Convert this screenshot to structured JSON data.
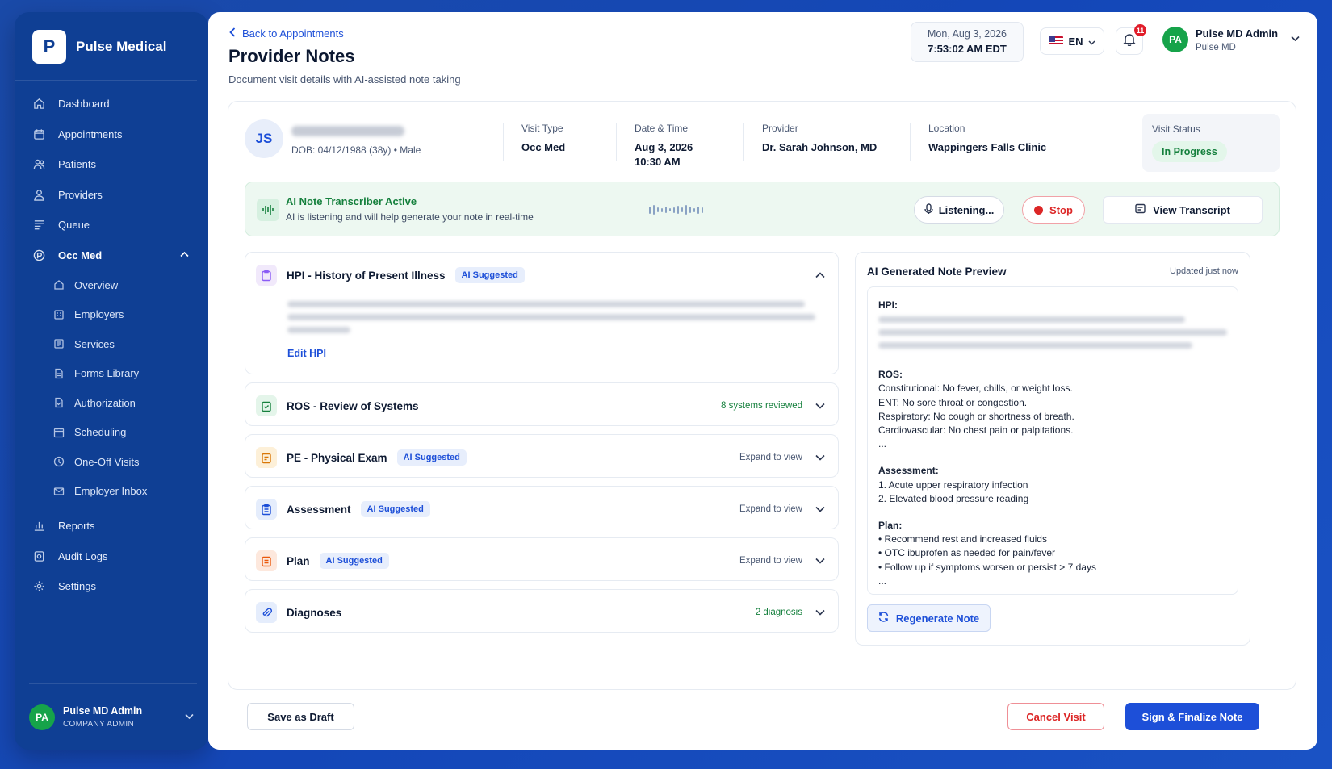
{
  "brand": {
    "logo_letter": "P",
    "name": "Pulse Medical"
  },
  "sidebar": {
    "items": [
      {
        "label": "Dashboard",
        "icon": "home-icon"
      },
      {
        "label": "Appointments",
        "icon": "calendar-icon"
      },
      {
        "label": "Patients",
        "icon": "users-icon"
      },
      {
        "label": "Providers",
        "icon": "provider-icon"
      },
      {
        "label": "Queue",
        "icon": "queue-icon"
      }
    ],
    "occ_med": {
      "label": "Occ Med",
      "sub_items": [
        {
          "label": "Overview"
        },
        {
          "label": "Employers"
        },
        {
          "label": "Services"
        },
        {
          "label": "Forms Library"
        },
        {
          "label": "Authorization"
        },
        {
          "label": "Scheduling"
        },
        {
          "label": "One-Off Visits"
        },
        {
          "label": "Employer Inbox"
        }
      ]
    },
    "bottom_items": [
      {
        "label": "Reports"
      },
      {
        "label": "Audit Logs"
      },
      {
        "label": "Settings"
      }
    ],
    "user": {
      "initials": "PA",
      "name": "Pulse MD Admin",
      "role": "COMPANY ADMIN"
    }
  },
  "header": {
    "back_link": "Back to Appointments",
    "title": "Provider Notes",
    "subtitle": "Document visit details with AI-assisted note taking",
    "date": "Mon, Aug 3, 2026",
    "time": "7:53:02 AM EDT",
    "language": "EN",
    "notification_count": "11",
    "user": {
      "initials": "PA",
      "name": "Pulse MD Admin",
      "org": "Pulse MD"
    }
  },
  "patient": {
    "initials": "JS",
    "dob_line": "DOB: 04/12/1988 (38y) • Male",
    "visit_type_label": "Visit Type",
    "visit_type": "Occ Med",
    "datetime_label": "Date & Time",
    "date": "Aug 3, 2026",
    "time": "10:30 AM",
    "provider_label": "Provider",
    "provider": "Dr. Sarah Johnson, MD",
    "location_label": "Location",
    "location": "Wappingers Falls Clinic",
    "status_label": "Visit Status",
    "status": "In Progress"
  },
  "ai_banner": {
    "title": "AI Note Transcriber Active",
    "subtitle": "AI is listening and will help generate your note in real-time",
    "listening_label": "Listening...",
    "stop_label": "Stop",
    "transcript_label": "View Transcript"
  },
  "sections": {
    "hpi": {
      "title": "HPI - History of Present Illness",
      "tag": "AI Suggested",
      "edit_label": "Edit HPI"
    },
    "ros": {
      "title": "ROS - Review of Systems",
      "right": "8 systems reviewed"
    },
    "pe": {
      "title": "PE - Physical Exam",
      "tag": "AI Suggested",
      "right": "Expand to view"
    },
    "assessment": {
      "title": "Assessment",
      "tag": "AI Suggested",
      "right": "Expand to view"
    },
    "plan": {
      "title": "Plan",
      "tag": "AI Suggested",
      "right": "Expand to view"
    },
    "diagnoses": {
      "title": "Diagnoses",
      "right": "2 diagnosis"
    }
  },
  "preview": {
    "title": "AI Generated Note Preview",
    "updated": "Updated just now",
    "hpi_heading": "HPI:",
    "ros_heading": "ROS:",
    "ros_lines": [
      "Constitutional: No fever, chills, or weight loss.",
      "ENT: No sore throat or congestion.",
      "Respiratory: No cough or shortness of breath.",
      "Cardiovascular: No chest pain or palpitations.",
      "..."
    ],
    "assessment_heading": "Assessment:",
    "assessment_lines": [
      "1.  Acute upper respiratory infection",
      "2.  Elevated blood pressure reading"
    ],
    "plan_heading": "Plan:",
    "plan_lines": [
      "•  Recommend rest and increased fluids",
      "•  OTC ibuprofen as needed for pain/fever",
      "•  Follow up if symptoms worsen or persist > 7 days",
      "..."
    ],
    "regenerate_label": "Regenerate Note"
  },
  "footer": {
    "draft_label": "Save as Draft",
    "cancel_label": "Cancel Visit",
    "sign_label": "Sign & Finalize Note"
  },
  "colors": {
    "primary": "#1d4fd8",
    "sidebar": "#0f3f94",
    "success": "#15803d",
    "danger": "#dc2626"
  }
}
